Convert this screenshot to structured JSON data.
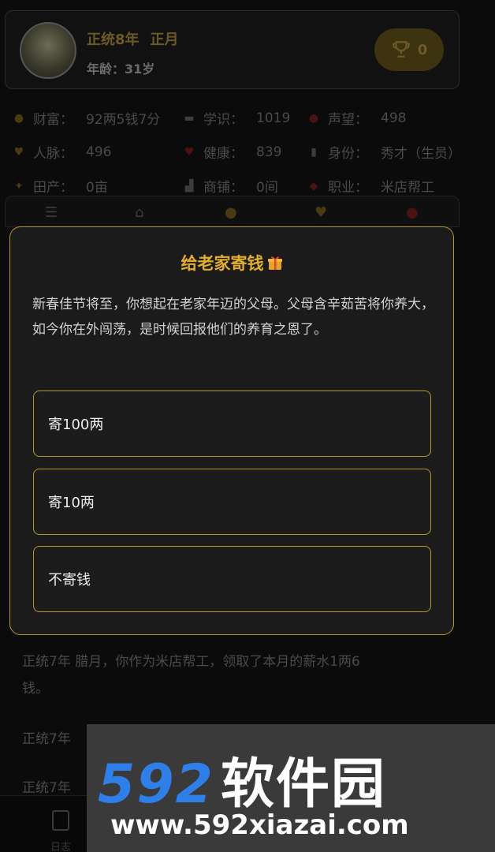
{
  "header": {
    "era": "正统8年",
    "month": "正月",
    "age": "年龄：31岁",
    "trophy_count": "0"
  },
  "stats": [
    [
      {
        "icon": "money-bag-icon",
        "label": "财富：",
        "value": "92两5钱7分"
      },
      {
        "icon": "book-icon",
        "label": "学识：",
        "value": "1019"
      },
      {
        "icon": "reputation-icon",
        "label": "声望：",
        "value": "498"
      }
    ],
    [
      {
        "icon": "heart-icon",
        "label": "人脉：",
        "value": "496"
      },
      {
        "icon": "health-heart-icon",
        "label": "健康：",
        "value": "839"
      },
      {
        "icon": "document-icon",
        "label": "身份：",
        "value": "秀才（生员）"
      }
    ],
    [
      {
        "icon": "farmland-icon",
        "label": "田产：",
        "value": "0亩"
      },
      {
        "icon": "shop-icon",
        "label": "商铺：",
        "value": "0间"
      },
      {
        "icon": "job-icon",
        "label": "职业：",
        "value": "米店帮工"
      }
    ]
  ],
  "log": [
    "正统7年 腊月，你作为米店帮工，领取了本月的薪水1两6",
    "钱。",
    "正统7年",
    "正统7年"
  ],
  "bottom_nav": {
    "label": "日志"
  },
  "modal": {
    "title": "给老家寄钱",
    "description": "新春佳节将至，你想起在老家年迈的父母。父母含辛茹苦将你养大，如今你在外闯荡，是时候回报他们的养育之恩了。",
    "options": [
      "寄100两",
      "寄10两",
      "不寄钱"
    ]
  },
  "watermark": {
    "logo_number": "592",
    "logo_text": "软件园",
    "url": "www.592xiazai.com"
  },
  "colors": {
    "accent_gold": "#e3ad2e",
    "border_gold": "#b8952c",
    "modal_bg": "#1b1b1b"
  }
}
